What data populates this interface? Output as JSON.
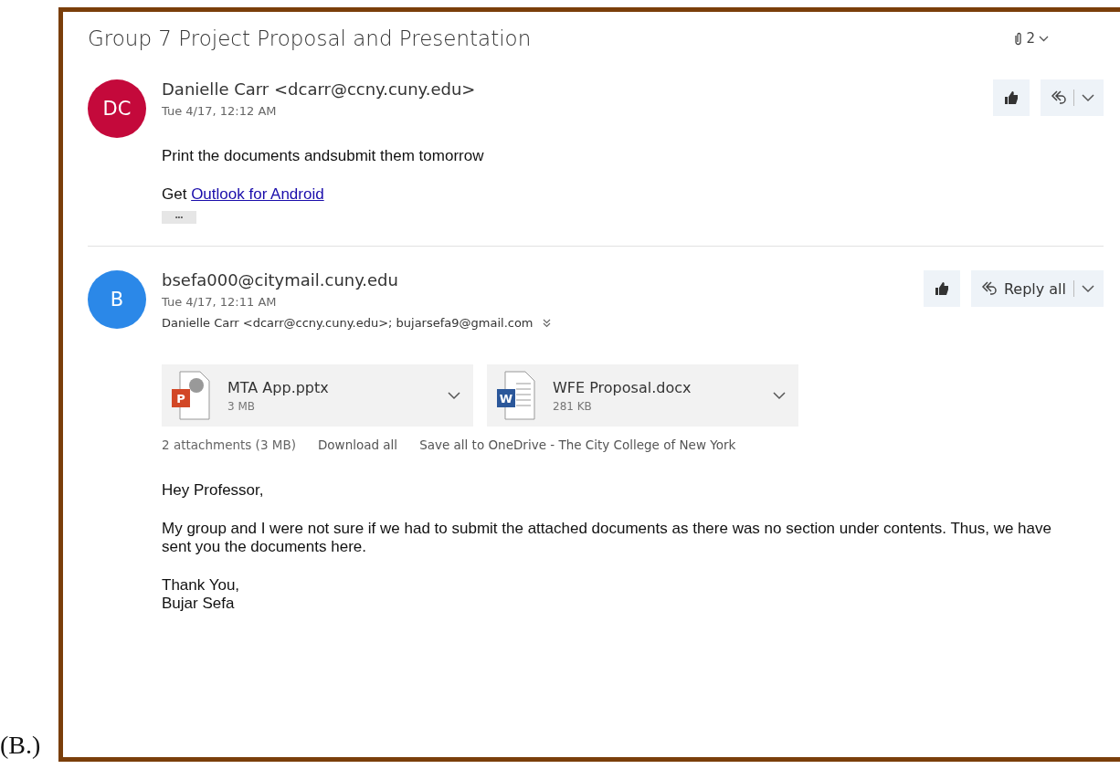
{
  "figure_label": "(B.)",
  "thread": {
    "subject": "Group 7 Project Proposal and Presentation",
    "attachment_count": "2",
    "messages": [
      {
        "avatar_initials": "DC",
        "color": "#c4093b",
        "sender": "Danielle Carr <dcarr@ccny.cuny.edu>",
        "date": "Tue 4/17, 12:12 AM",
        "body": [
          {
            "kind": "text",
            "text": "Print the documents andsubmit them tomorrow"
          },
          {
            "kind": "link_line",
            "prefix": "Get",
            "link": "Outlook for Android"
          },
          {
            "kind": "more",
            "text": "•••"
          }
        ]
      },
      {
        "avatar_initials": "B",
        "color": "#2b88e8",
        "sender": "bsefa000@citymail.cuny.edu",
        "date": "Tue 4/17, 12:11 AM",
        "reply_label": "Reply all",
        "recipients": "Danielle Carr <dcarr@ccny.cuny.edu>; bujarsefa9@gmail.com",
        "attachments": [
          {
            "kind": "pptx",
            "icon_letter": "P",
            "name": "MTA App.pptx",
            "size": "3 MB"
          },
          {
            "kind": "docx",
            "icon_letter": "W",
            "name": "WFE Proposal.docx",
            "size": "281 KB"
          }
        ],
        "attachment_summary": {
          "count": "2 attachments (3 MB)",
          "actions": [
            "Download all",
            "Save all to OneDrive - The City College of New York"
          ]
        },
        "body": [
          {
            "kind": "text",
            "text": "Hey Professor,"
          },
          {
            "kind": "text",
            "text": "My group and I were not sure if we had to submit the attached documents as there was no section under contents. Thus, we have sent you the documents here."
          },
          {
            "kind": "lines",
            "lines": [
              "Thank You,",
              "Bujar Sefa"
            ]
          }
        ]
      }
    ]
  }
}
